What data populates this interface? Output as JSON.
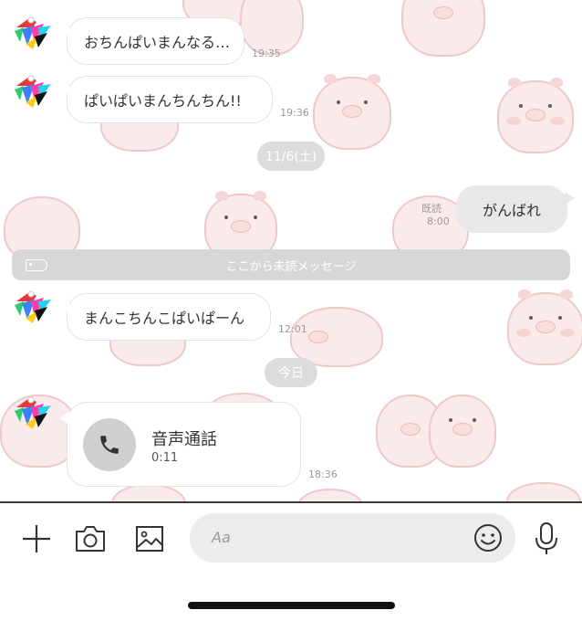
{
  "messages": [
    {
      "text": "おちんぱいまんなる…",
      "time": "19:35"
    },
    {
      "text": "ぱいぱいまんちんちん!!",
      "time": "19:36"
    },
    {
      "text": "がんばれ",
      "read_status": "既読",
      "time": "8:00"
    },
    {
      "text": "まんこちんこぱいぱーん",
      "time": "12:01"
    }
  ],
  "dates": {
    "first": "11/6(土)",
    "today": "今日"
  },
  "unread_divider": "ここから未読メッセージ",
  "call": {
    "title": "音声通話",
    "duration": "0:11",
    "time": "18:36"
  },
  "input": {
    "placeholder": "Aa"
  },
  "icons": {
    "avatar": "reindeer-avatar-icon",
    "add": "plus-icon",
    "camera": "camera-icon",
    "gallery": "image-icon",
    "emoji": "smiley-icon",
    "mic": "microphone-icon",
    "phone": "phone-icon",
    "unread_tag": "tag-icon"
  },
  "colors": {
    "outgoing_bubble": "#e8e8e8",
    "date_pill": "#dcdcdc",
    "unread_bar": "#d7d7d7",
    "pig": "#fbeaea"
  }
}
